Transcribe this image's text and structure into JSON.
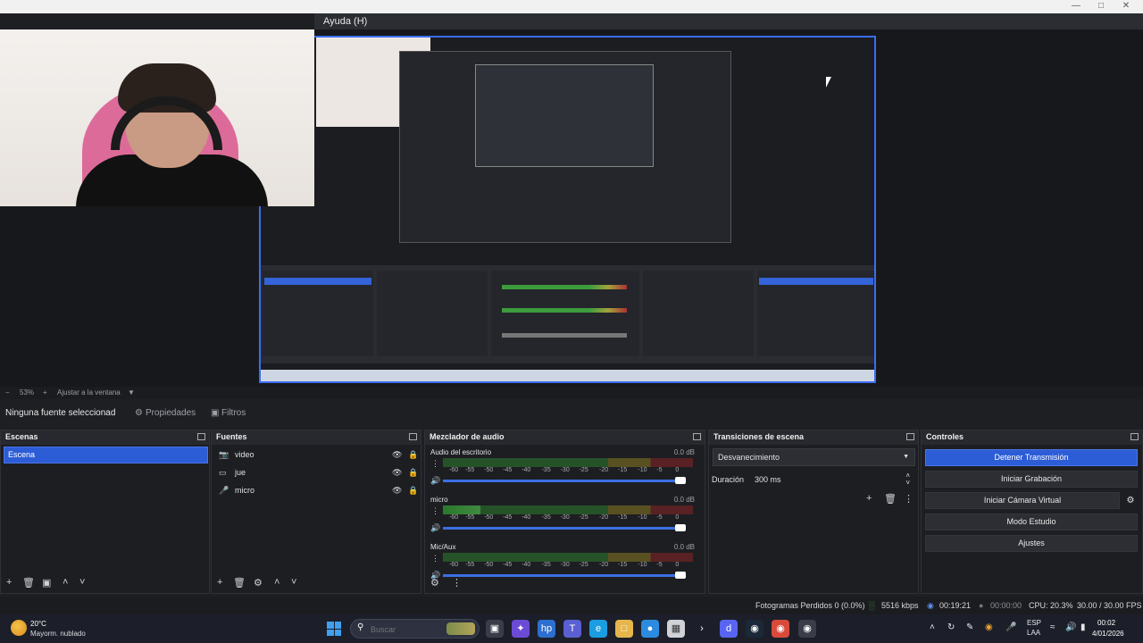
{
  "window": {
    "menu_help": "Ayuda (H)"
  },
  "zoom": {
    "level": "53%",
    "fit_label": "Ajustar a la ventana"
  },
  "source_toolbar": {
    "no_source": "Ninguna fuente seleccionad",
    "properties": "Propiedades",
    "filters": "Filtros"
  },
  "scenes": {
    "title": "Escenas",
    "items": [
      "Escena"
    ]
  },
  "sources": {
    "title": "Fuentes",
    "items": [
      {
        "label": "video",
        "icon": "camera-icon"
      },
      {
        "label": "jue",
        "icon": "monitor-icon"
      },
      {
        "label": "micro",
        "icon": "microphone-icon"
      }
    ]
  },
  "mixer": {
    "title": "Mezclador de audio",
    "ticks": [
      "-60",
      "-55",
      "-50",
      "-45",
      "-40",
      "-35",
      "-30",
      "-25",
      "-20",
      "-15",
      "-10",
      "-5",
      "0"
    ],
    "channels": [
      {
        "name": "Audio del escritorio",
        "db": "0.0 dB",
        "level": 0.0,
        "volume": 1.0
      },
      {
        "name": "micro",
        "db": "0.0 dB",
        "level": 0.15,
        "volume": 1.0
      },
      {
        "name": "Mic/Aux",
        "db": "0.0 dB",
        "level": 0.0,
        "volume": 1.0
      }
    ]
  },
  "transitions": {
    "title": "Transiciones de escena",
    "selected": "Desvanecimiento",
    "duration_label": "Duración",
    "duration_value": "300 ms"
  },
  "controls": {
    "title": "Controles",
    "stop_stream": "Detener Transmisión",
    "start_record": "Iniciar Grabación",
    "virtual_cam": "Iniciar Cámara Virtual",
    "studio_mode": "Modo Estudio",
    "settings": "Ajustes"
  },
  "status": {
    "dropped": "Fotogramas Perdidos 0 (0.0%)",
    "bitrate": "5516 kbps",
    "stream_time": "00:19:21",
    "record_time": "00:00:00",
    "cpu": "CPU: 20.3%",
    "fps": "30.00 / 30.00 FPS"
  },
  "taskbar": {
    "temp": "20°C",
    "weather": "Mayorm. nublado",
    "search_placeholder": "Buscar",
    "lang_top": "ESP",
    "lang_bottom": "LAA",
    "time": "00:02",
    "date": "4/01/2026"
  },
  "colors": {
    "accent": "#2c5cd6",
    "meter_green": "#37c337",
    "background": "#1e1f23"
  }
}
